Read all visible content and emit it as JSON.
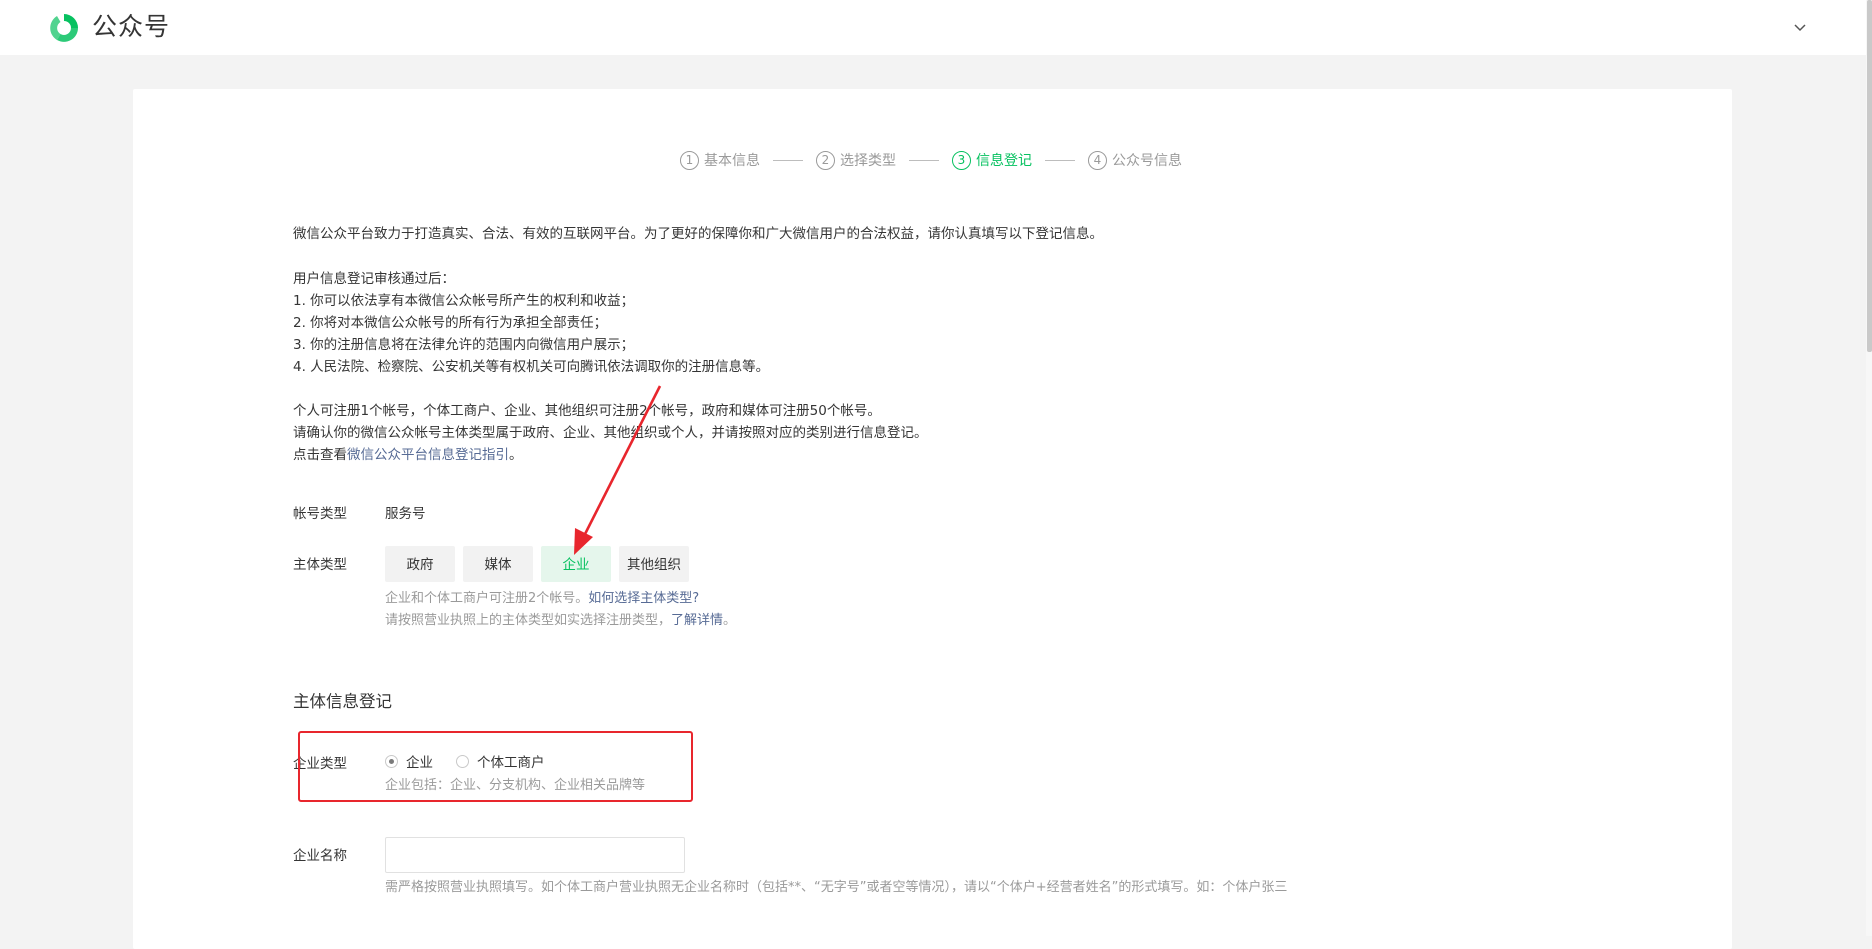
{
  "header": {
    "brand": "公众号",
    "logo_icon": "wechat-official-account-logo",
    "menu_icon": "chevron-down-icon"
  },
  "stepper": [
    {
      "num": "1",
      "label": "基本信息",
      "active": false
    },
    {
      "num": "2",
      "label": "选择类型",
      "active": false
    },
    {
      "num": "3",
      "label": "信息登记",
      "active": true
    },
    {
      "num": "4",
      "label": "公众号信息",
      "active": false
    }
  ],
  "intro": "微信公众平台致力于打造真实、合法、有效的互联网平台。为了更好的保障你和广大微信用户的合法权益，请你认真填写以下登记信息。",
  "after_review": {
    "title": "用户信息登记审核通过后：",
    "items": [
      "1. 你可以依法享有本微信公众帐号所产生的权利和收益；",
      "2. 你将对本微信公众帐号的所有行为承担全部责任；",
      "3. 你的注册信息将在法律允许的范围内向微信用户展示；",
      "4. 人民法院、检察院、公安机关等有权机关可向腾讯依法调取你的注册信息等。"
    ]
  },
  "notice": {
    "line1": "个人可注册1个帐号，个体工商户、企业、其他组织可注册2个帐号，政府和媒体可注册50个帐号。",
    "line2": "请确认你的微信公众帐号主体类型属于政府、企业、其他组织或个人，并请按照对应的类别进行信息登记。",
    "line3_prefix": "点击查看",
    "line3_link": "微信公众平台信息登记指引",
    "line3_suffix": "。"
  },
  "account_type": {
    "label": "帐号类型",
    "value": "服务号"
  },
  "subject_type": {
    "label": "主体类型",
    "options": [
      "政府",
      "媒体",
      "企业",
      "其他组织"
    ],
    "selected": "企业",
    "hint1_text": "企业和个体工商户可注册2个帐号。",
    "hint1_link": "如何选择主体类型?",
    "hint2_text": "请按照营业执照上的主体类型如实选择注册类型，",
    "hint2_link": "了解详情",
    "hint2_suffix": "。"
  },
  "section_title": "主体信息登记",
  "enterprise_type": {
    "label": "企业类型",
    "options": [
      {
        "label": "企业",
        "checked": true
      },
      {
        "label": "个体工商户",
        "checked": false
      }
    ],
    "hint": "企业包括：企业、分支机构、企业相关品牌等"
  },
  "enterprise_name": {
    "label": "企业名称",
    "value": "",
    "hint": "需严格按照营业执照填写。如个体工商户营业执照无企业名称时（包括**、“无字号”或者空等情况），请以“个体户+经营者姓名”的形式填写。如：个体户张三"
  },
  "colors": {
    "accent": "#07c160",
    "link": "#576b95",
    "annotation": "#e8262d"
  }
}
